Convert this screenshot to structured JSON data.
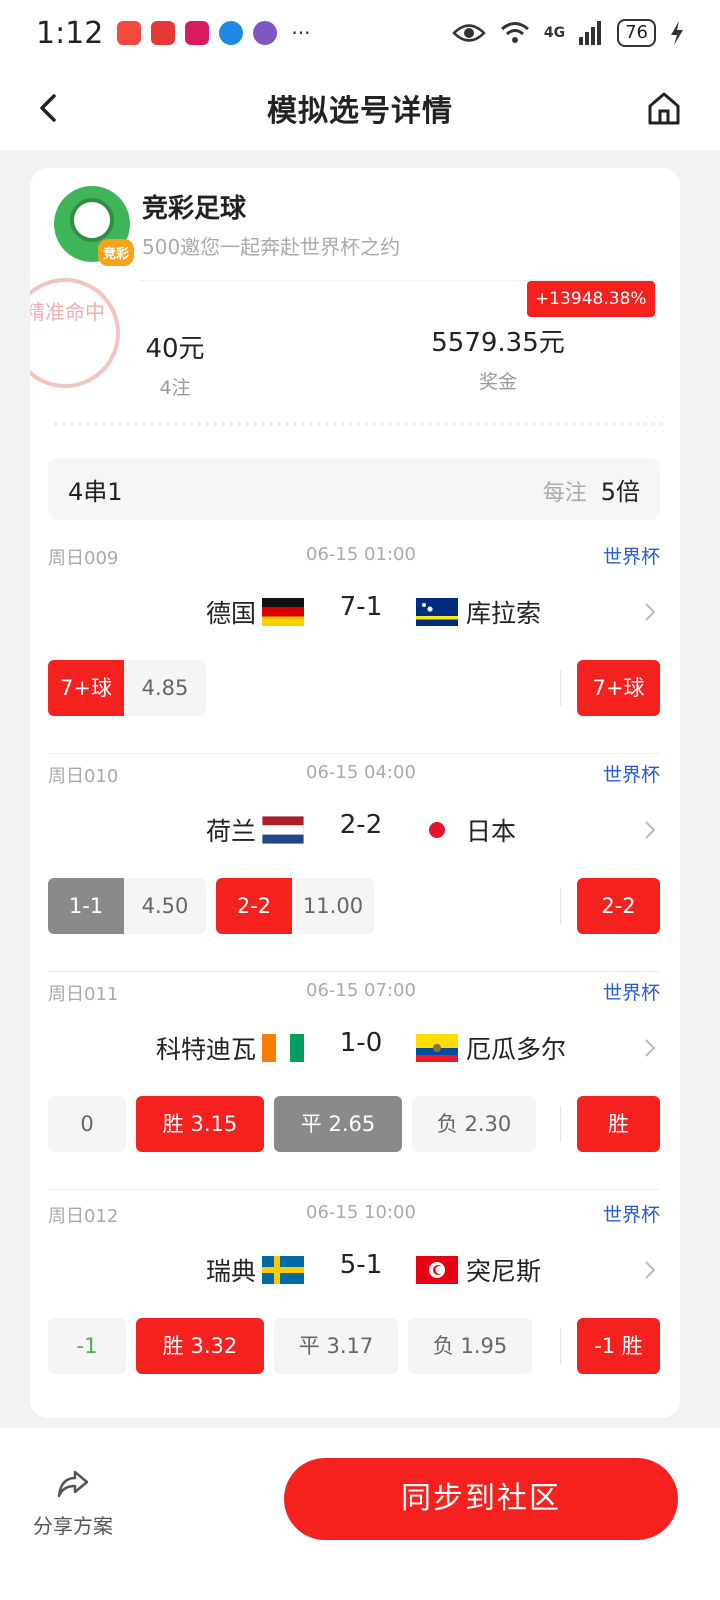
{
  "status_bar": {
    "time": "1:12",
    "network": "4G",
    "battery": "76"
  },
  "nav": {
    "title": "模拟选号详情"
  },
  "lottery": {
    "name": "竞彩足球",
    "slogan": "500邀您一起奔赴世界杯之约",
    "logo_badge": "竞彩"
  },
  "stamp_text": "精准命中",
  "summary": {
    "amount": "40元",
    "bets": "4注",
    "prize": "5579.35元",
    "prize_label": "奖金",
    "percent": "+13948.38%"
  },
  "bet_bar": {
    "type": "4串1",
    "mult_label": "每注",
    "mult": "5倍"
  },
  "matches": [
    {
      "code": "周日009",
      "time": "06-15 01:00",
      "league": "世界杯",
      "home": "德国",
      "score": "7-1",
      "away": "库拉索",
      "picks": [
        {
          "label": "7+球",
          "odds": "4.85"
        }
      ],
      "result": "7+球"
    },
    {
      "code": "周日010",
      "time": "06-15 04:00",
      "league": "世界杯",
      "home": "荷兰",
      "score": "2-2",
      "away": "日本",
      "picks": [
        {
          "label": "1-1",
          "odds": "4.50"
        },
        {
          "label": "2-2",
          "odds": "11.00"
        }
      ],
      "result": "2-2"
    },
    {
      "code": "周日011",
      "time": "06-15 07:00",
      "league": "世界杯",
      "home": "科特迪瓦",
      "score": "1-0",
      "away": "厄瓜多尔",
      "handicap": "0",
      "options": [
        "胜 3.15",
        "平 2.65",
        "负 2.30"
      ],
      "result": "胜"
    },
    {
      "code": "周日012",
      "time": "06-15 10:00",
      "league": "世界杯",
      "home": "瑞典",
      "score": "5-1",
      "away": "突尼斯",
      "handicap": "-1",
      "options": [
        "胜 3.32",
        "平 3.17",
        "负 1.95"
      ],
      "result": "-1 胜"
    }
  ],
  "bottom": {
    "share_label": "分享方案",
    "sync_label": "同步到社区"
  },
  "colors": {
    "accent": "#f4211f",
    "league_blue": "#2a5bd7",
    "selected_grey": "#8a8a8a"
  }
}
